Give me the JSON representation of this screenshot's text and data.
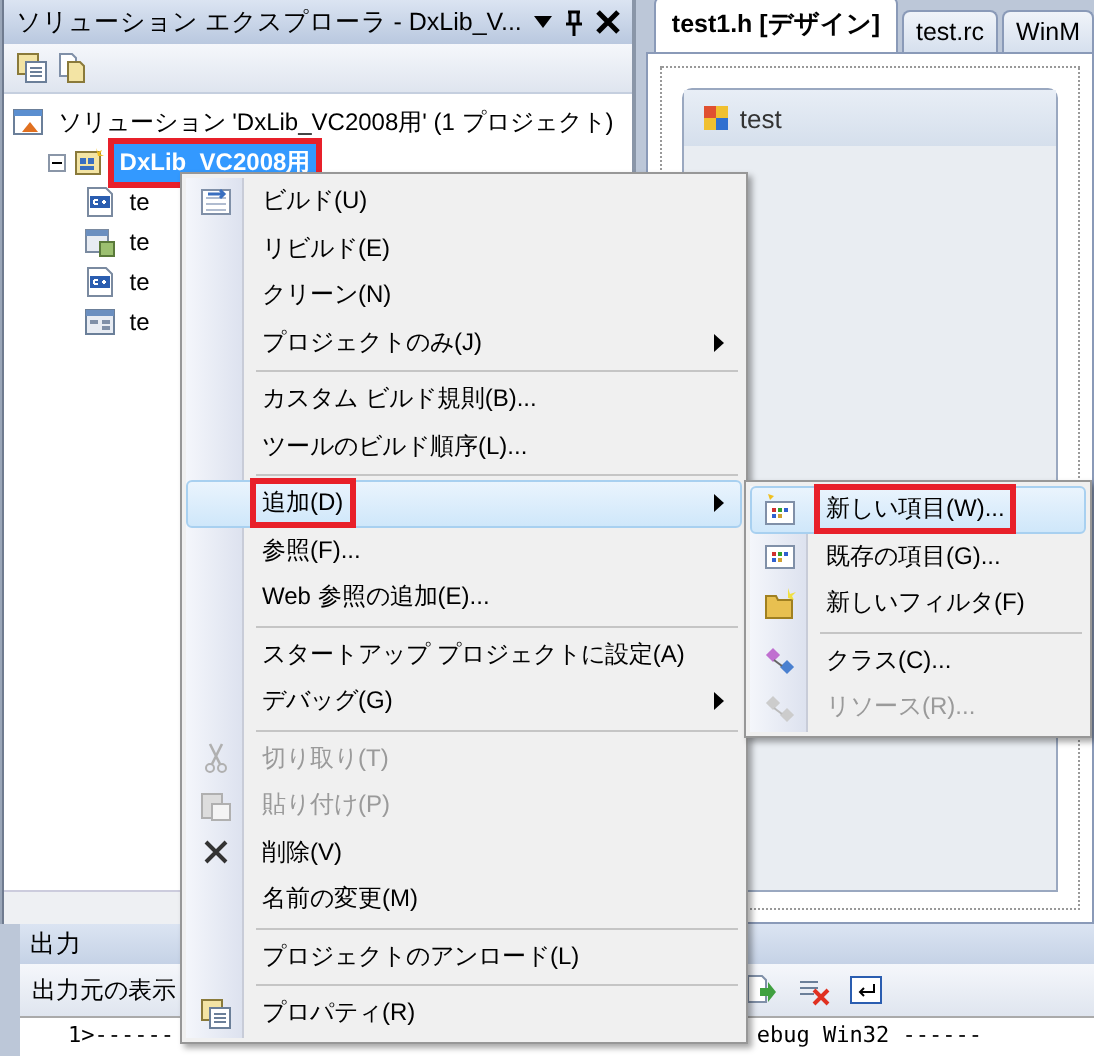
{
  "explorer": {
    "title": "ソリューション エクスプローラ - DxLib_V...",
    "tree": [
      {
        "label": "ソリューション 'DxLib_VC2008用' (1 プロジェクト)",
        "kind": "solution",
        "selected": false,
        "highlighted": false,
        "children": [
          {
            "label": "DxLib_VC2008用",
            "kind": "project",
            "selected": true,
            "highlighted": true,
            "expanded": true,
            "children": [
              {
                "label": "te",
                "kind": "cpp",
                "selected": false,
                "highlighted": false
              },
              {
                "label": "te",
                "kind": "resource",
                "selected": false,
                "highlighted": false
              },
              {
                "label": "te",
                "kind": "cpp",
                "selected": false,
                "highlighted": false
              },
              {
                "label": "te",
                "kind": "header",
                "selected": false,
                "highlighted": false
              }
            ]
          }
        ]
      }
    ]
  },
  "editor": {
    "tabs": [
      {
        "label": "test1.h [デザイン]",
        "selected": true
      },
      {
        "label": "test.rc",
        "selected": false
      },
      {
        "label": "WinM",
        "selected": false
      }
    ],
    "form": {
      "title": "test"
    }
  },
  "output": {
    "title": "出力",
    "source_label": "出力元の表示",
    "lines": [
      "1>------",
      "ebug Win32 ------"
    ]
  },
  "context_menu": {
    "items": [
      {
        "kind": "item",
        "label": "ビルド(U)",
        "submenu": false,
        "disabled": false,
        "selected": false,
        "highlighted": false
      },
      {
        "kind": "item",
        "label": "リビルド(E)",
        "submenu": false,
        "disabled": false,
        "selected": false,
        "highlighted": false
      },
      {
        "kind": "item",
        "label": "クリーン(N)",
        "submenu": false,
        "disabled": false,
        "selected": false,
        "highlighted": false
      },
      {
        "kind": "item",
        "label": "プロジェクトのみ(J)",
        "submenu": true,
        "disabled": false,
        "selected": false,
        "highlighted": false
      },
      {
        "kind": "separator"
      },
      {
        "kind": "item",
        "label": "カスタム ビルド規則(B)...",
        "submenu": false,
        "disabled": false,
        "selected": false,
        "highlighted": false
      },
      {
        "kind": "item",
        "label": "ツールのビルド順序(L)...",
        "submenu": false,
        "disabled": false,
        "selected": false,
        "highlighted": false
      },
      {
        "kind": "separator"
      },
      {
        "kind": "item",
        "label": "追加(D)",
        "submenu": true,
        "disabled": false,
        "selected": true,
        "highlighted": true
      },
      {
        "kind": "item",
        "label": "参照(F)...",
        "submenu": false,
        "disabled": false,
        "selected": false,
        "highlighted": false
      },
      {
        "kind": "item",
        "label": "Web 参照の追加(E)...",
        "submenu": false,
        "disabled": false,
        "selected": false,
        "highlighted": false
      },
      {
        "kind": "separator"
      },
      {
        "kind": "item",
        "label": "スタートアップ プロジェクトに設定(A)",
        "submenu": false,
        "disabled": false,
        "selected": false,
        "highlighted": false
      },
      {
        "kind": "item",
        "label": "デバッグ(G)",
        "submenu": true,
        "disabled": false,
        "selected": false,
        "highlighted": false
      },
      {
        "kind": "separator"
      },
      {
        "kind": "item",
        "label": "切り取り(T)",
        "submenu": false,
        "disabled": true,
        "selected": false,
        "highlighted": false
      },
      {
        "kind": "item",
        "label": "貼り付け(P)",
        "submenu": false,
        "disabled": true,
        "selected": false,
        "highlighted": false
      },
      {
        "kind": "item",
        "label": "削除(V)",
        "submenu": false,
        "disabled": false,
        "selected": false,
        "highlighted": false
      },
      {
        "kind": "item",
        "label": "名前の変更(M)",
        "submenu": false,
        "disabled": false,
        "selected": false,
        "highlighted": false
      },
      {
        "kind": "separator"
      },
      {
        "kind": "item",
        "label": "プロジェクトのアンロード(L)",
        "submenu": false,
        "disabled": false,
        "selected": false,
        "highlighted": false
      },
      {
        "kind": "separator"
      },
      {
        "kind": "item",
        "label": "プロパティ(R)",
        "submenu": false,
        "disabled": false,
        "selected": false,
        "highlighted": false
      }
    ]
  },
  "submenu": {
    "items": [
      {
        "kind": "item",
        "label": "新しい項目(W)...",
        "disabled": false,
        "selected": true,
        "highlighted": true
      },
      {
        "kind": "item",
        "label": "既存の項目(G)...",
        "disabled": false,
        "selected": false,
        "highlighted": false
      },
      {
        "kind": "item",
        "label": "新しいフィルタ(F)",
        "disabled": false,
        "selected": false,
        "highlighted": false
      },
      {
        "kind": "separator"
      },
      {
        "kind": "item",
        "label": "クラス(C)...",
        "disabled": false,
        "selected": false,
        "highlighted": false
      },
      {
        "kind": "item",
        "label": "リソース(R)...",
        "disabled": true,
        "selected": false,
        "highlighted": false
      }
    ]
  }
}
